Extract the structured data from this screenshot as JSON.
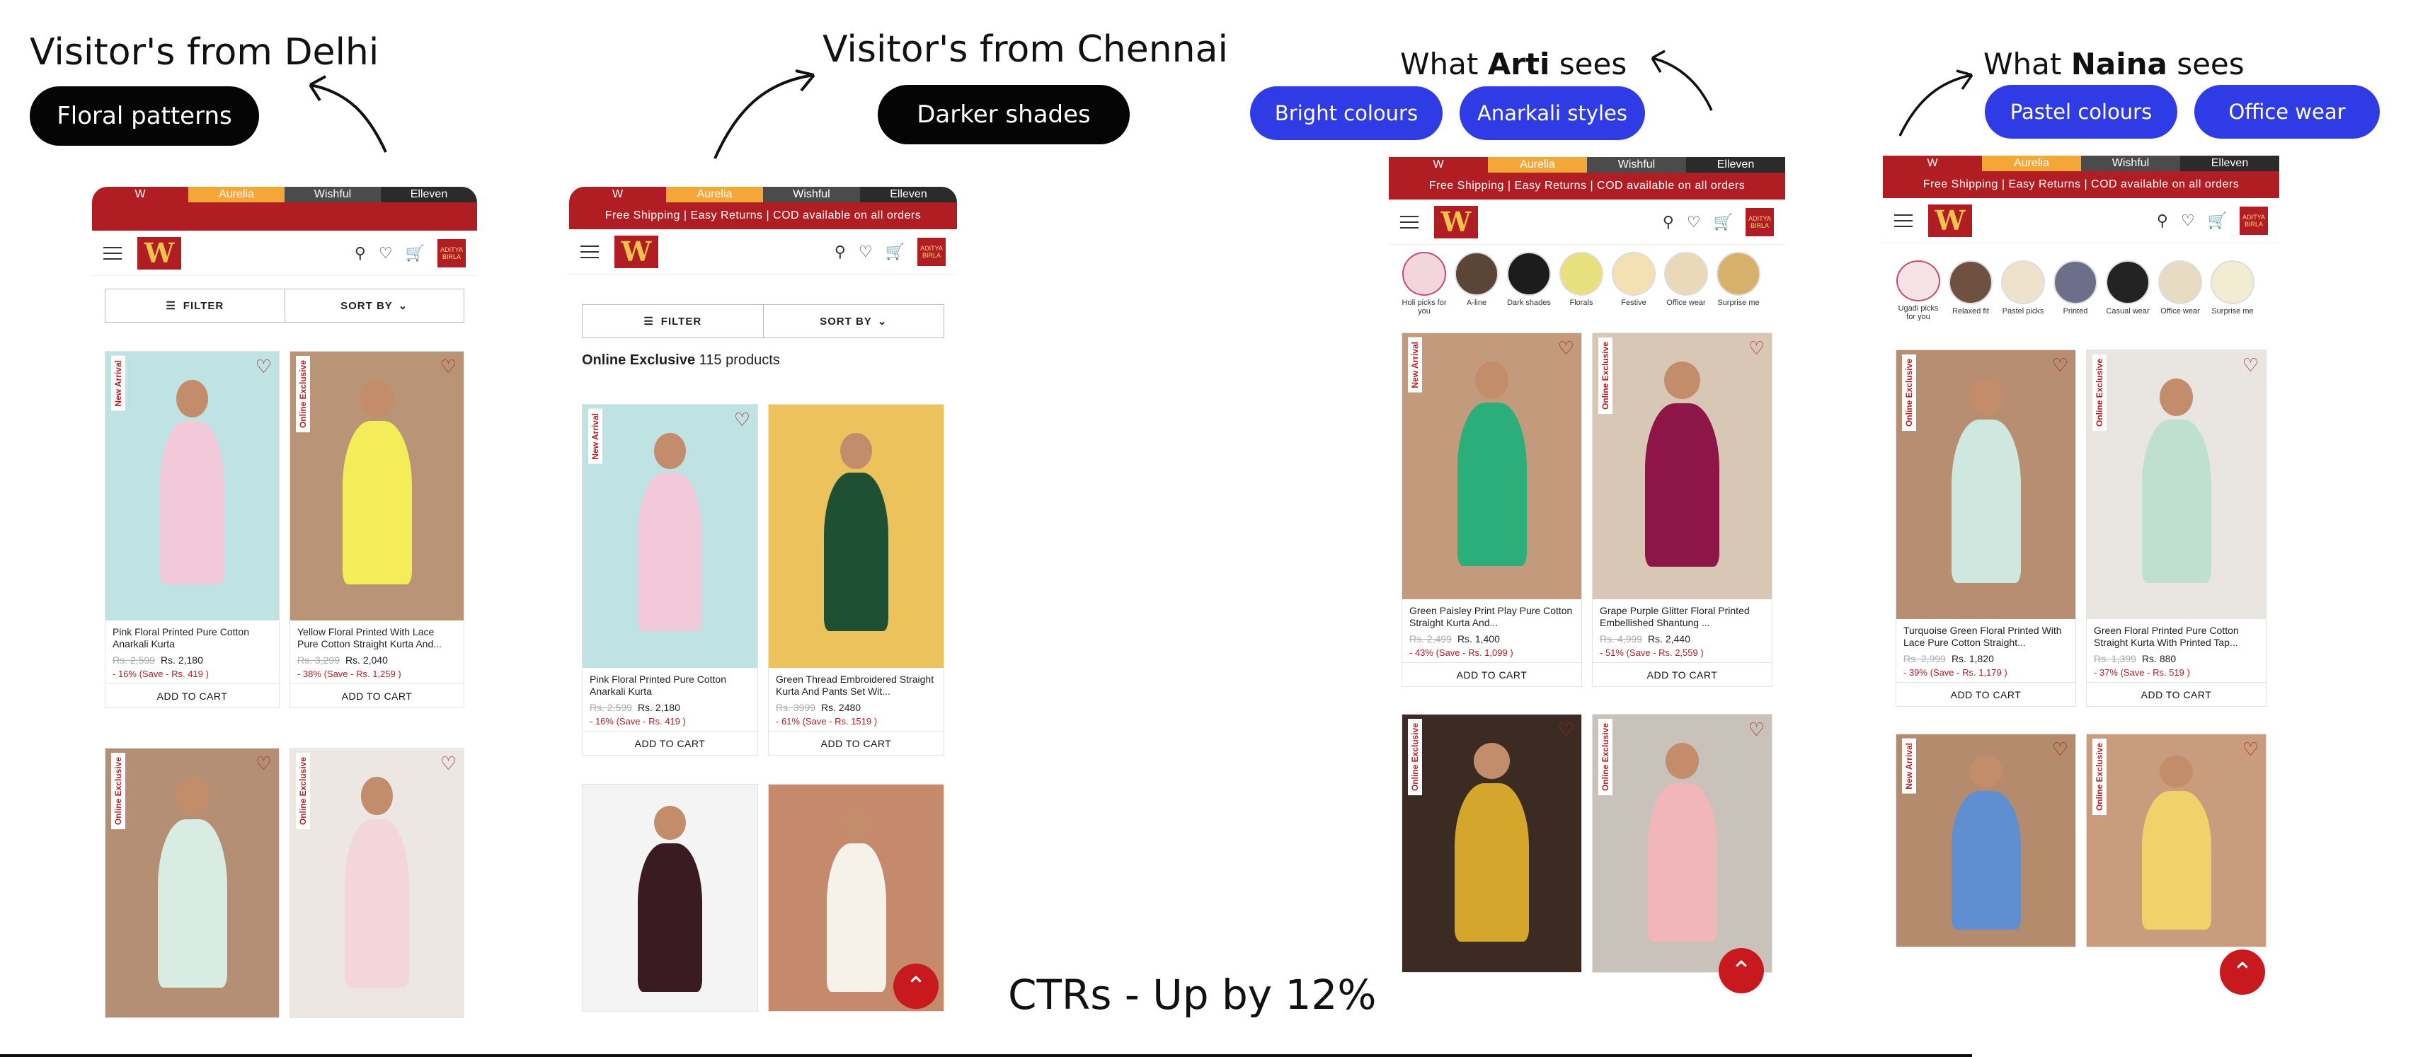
{
  "delhi": {
    "caption": "Visitor's from Delhi",
    "tag": "Floral patterns"
  },
  "chennai": {
    "caption": "Visitor's from Chennai",
    "tag": "Darker shades"
  },
  "arti": {
    "caption_pre": "What ",
    "caption_name": "Arti",
    "caption_post": " sees",
    "tags": [
      "Bright colours",
      "Anarkali styles"
    ]
  },
  "naina": {
    "caption_pre": "What ",
    "caption_name": "Naina",
    "caption_post": " sees",
    "tags": [
      "Pastel colours",
      "Office wear"
    ]
  },
  "ctr_text": "CTRs - Up by 12%",
  "brands": [
    "W",
    "Aurelia",
    "Wishful",
    "Elleven"
  ],
  "shipping_text": "Free Shipping | Easy Returns | COD available on all orders",
  "logo_letter": "W",
  "badge_text": "ADITYA BIRLA",
  "filter_label": "FILTER",
  "sort_label": "SORT BY",
  "collection": {
    "title": "Online Exclusive",
    "count": "115 products"
  },
  "add_to_cart": "ADD TO CART",
  "colors": {
    "brand_red": "#b01e23",
    "aurelia_orange": "#f4a636",
    "pill_blue": "#2f3ce6",
    "pill_black": "#050505"
  },
  "icons": [
    "search-icon",
    "heart-icon",
    "cart-icon",
    "hamburger-icon",
    "filter-icon",
    "chevron-down-icon",
    "arrow-up-icon"
  ],
  "phone1": {
    "products": [
      {
        "tag": "New Arrival",
        "name": "Pink Floral Printed Pure Cotton Anarkali Kurta",
        "mrp": "Rs. 2,599",
        "price": "Rs. 2,180",
        "save": "- 16% (Save - Rs. 419 )"
      },
      {
        "tag": "Online Exclusive",
        "name": "Yellow Floral Printed With Lace Pure Cotton Straight Kurta And...",
        "mrp": "Rs. 3,299",
        "price": "Rs. 2,040",
        "save": "- 38% (Save - Rs. 1,259 )"
      },
      {
        "tag": "Online Exclusive"
      },
      {
        "tag": "Online Exclusive"
      }
    ]
  },
  "phone2": {
    "products": [
      {
        "tag": "New Arrival",
        "name": "Pink Floral Printed Pure Cotton Anarkali Kurta",
        "mrp": "Rs. 2,599",
        "price": "Rs. 2,180",
        "save": "- 16% (Save - Rs. 419 )"
      },
      {
        "tag": "",
        "name": "Green Thread Embroidered Straight Kurta And Pants Set Wit...",
        "mrp": "Rs. 3999",
        "price": "Rs. 2480",
        "save": "- 61% (Save - Rs. 1519 )"
      },
      {
        "tag": ""
      },
      {
        "tag": ""
      }
    ]
  },
  "phone3": {
    "categories": [
      "Holi picks for you",
      "A-line",
      "Dark shades",
      "Florals",
      "Festive",
      "Office wear",
      "Surprise me"
    ],
    "products": [
      {
        "tag": "New Arrival",
        "name": "Green Paisley Print Play Pure Cotton Straight Kurta And...",
        "mrp": "Rs. 2,499",
        "price": "Rs. 1,400",
        "save": "- 43% (Save - Rs. 1,099 )"
      },
      {
        "tag": "Online Exclusive",
        "name": "Grape Purple Glitter Floral Printed Embellished Shantung ...",
        "mrp": "Rs. 4,999",
        "price": "Rs. 2,440",
        "save": "- 51% (Save - Rs. 2,559 )"
      },
      {
        "tag": "Online Exclusive"
      },
      {
        "tag": "Online Exclusive"
      }
    ]
  },
  "phone4": {
    "categories": [
      "Ugadi picks for you",
      "Relaxed fit",
      "Pastel picks",
      "Printed",
      "Casual wear",
      "Office wear",
      "Surprise me"
    ],
    "products": [
      {
        "tag": "Online Exclusive",
        "name": "Turquoise Green Floral Printed With Lace Pure Cotton Straight...",
        "mrp": "Rs. 2,999",
        "price": "Rs. 1,820",
        "save": "- 39% (Save - Rs. 1,179 )"
      },
      {
        "tag": "Online Exclusive",
        "name": "Green Floral Printed Pure Cotton Straight Kurta With Printed Tap...",
        "mrp": "Rs. 1,399",
        "price": "Rs. 880",
        "save": "- 37% (Save - Rs. 519 )"
      },
      {
        "tag": "New Arrival"
      },
      {
        "tag": "Online Exclusive"
      }
    ]
  }
}
